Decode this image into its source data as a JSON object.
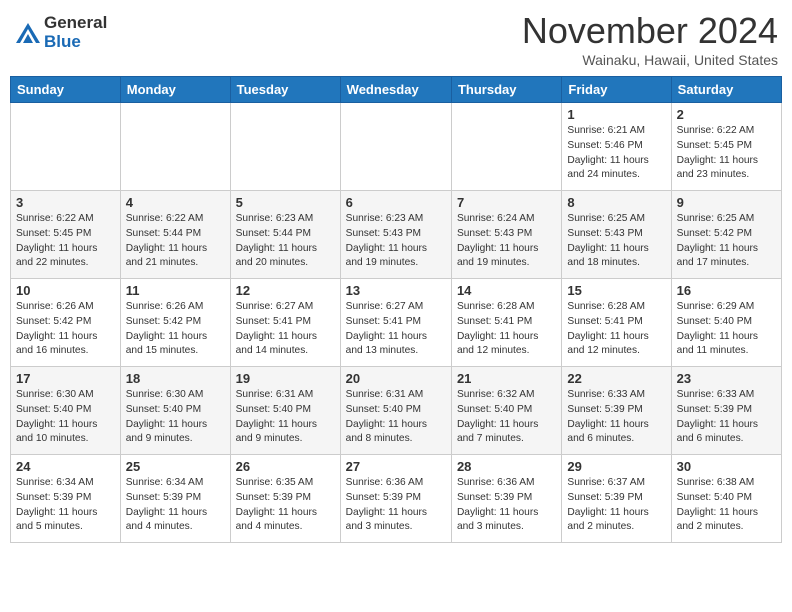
{
  "header": {
    "logo_general": "General",
    "logo_blue": "Blue",
    "month_title": "November 2024",
    "location": "Wainaku, Hawaii, United States"
  },
  "days_of_week": [
    "Sunday",
    "Monday",
    "Tuesday",
    "Wednesday",
    "Thursday",
    "Friday",
    "Saturday"
  ],
  "weeks": [
    [
      {
        "day": "",
        "info": ""
      },
      {
        "day": "",
        "info": ""
      },
      {
        "day": "",
        "info": ""
      },
      {
        "day": "",
        "info": ""
      },
      {
        "day": "",
        "info": ""
      },
      {
        "day": "1",
        "info": "Sunrise: 6:21 AM\nSunset: 5:46 PM\nDaylight: 11 hours and 24 minutes."
      },
      {
        "day": "2",
        "info": "Sunrise: 6:22 AM\nSunset: 5:45 PM\nDaylight: 11 hours and 23 minutes."
      }
    ],
    [
      {
        "day": "3",
        "info": "Sunrise: 6:22 AM\nSunset: 5:45 PM\nDaylight: 11 hours and 22 minutes."
      },
      {
        "day": "4",
        "info": "Sunrise: 6:22 AM\nSunset: 5:44 PM\nDaylight: 11 hours and 21 minutes."
      },
      {
        "day": "5",
        "info": "Sunrise: 6:23 AM\nSunset: 5:44 PM\nDaylight: 11 hours and 20 minutes."
      },
      {
        "day": "6",
        "info": "Sunrise: 6:23 AM\nSunset: 5:43 PM\nDaylight: 11 hours and 19 minutes."
      },
      {
        "day": "7",
        "info": "Sunrise: 6:24 AM\nSunset: 5:43 PM\nDaylight: 11 hours and 19 minutes."
      },
      {
        "day": "8",
        "info": "Sunrise: 6:25 AM\nSunset: 5:43 PM\nDaylight: 11 hours and 18 minutes."
      },
      {
        "day": "9",
        "info": "Sunrise: 6:25 AM\nSunset: 5:42 PM\nDaylight: 11 hours and 17 minutes."
      }
    ],
    [
      {
        "day": "10",
        "info": "Sunrise: 6:26 AM\nSunset: 5:42 PM\nDaylight: 11 hours and 16 minutes."
      },
      {
        "day": "11",
        "info": "Sunrise: 6:26 AM\nSunset: 5:42 PM\nDaylight: 11 hours and 15 minutes."
      },
      {
        "day": "12",
        "info": "Sunrise: 6:27 AM\nSunset: 5:41 PM\nDaylight: 11 hours and 14 minutes."
      },
      {
        "day": "13",
        "info": "Sunrise: 6:27 AM\nSunset: 5:41 PM\nDaylight: 11 hours and 13 minutes."
      },
      {
        "day": "14",
        "info": "Sunrise: 6:28 AM\nSunset: 5:41 PM\nDaylight: 11 hours and 12 minutes."
      },
      {
        "day": "15",
        "info": "Sunrise: 6:28 AM\nSunset: 5:41 PM\nDaylight: 11 hours and 12 minutes."
      },
      {
        "day": "16",
        "info": "Sunrise: 6:29 AM\nSunset: 5:40 PM\nDaylight: 11 hours and 11 minutes."
      }
    ],
    [
      {
        "day": "17",
        "info": "Sunrise: 6:30 AM\nSunset: 5:40 PM\nDaylight: 11 hours and 10 minutes."
      },
      {
        "day": "18",
        "info": "Sunrise: 6:30 AM\nSunset: 5:40 PM\nDaylight: 11 hours and 9 minutes."
      },
      {
        "day": "19",
        "info": "Sunrise: 6:31 AM\nSunset: 5:40 PM\nDaylight: 11 hours and 9 minutes."
      },
      {
        "day": "20",
        "info": "Sunrise: 6:31 AM\nSunset: 5:40 PM\nDaylight: 11 hours and 8 minutes."
      },
      {
        "day": "21",
        "info": "Sunrise: 6:32 AM\nSunset: 5:40 PM\nDaylight: 11 hours and 7 minutes."
      },
      {
        "day": "22",
        "info": "Sunrise: 6:33 AM\nSunset: 5:39 PM\nDaylight: 11 hours and 6 minutes."
      },
      {
        "day": "23",
        "info": "Sunrise: 6:33 AM\nSunset: 5:39 PM\nDaylight: 11 hours and 6 minutes."
      }
    ],
    [
      {
        "day": "24",
        "info": "Sunrise: 6:34 AM\nSunset: 5:39 PM\nDaylight: 11 hours and 5 minutes."
      },
      {
        "day": "25",
        "info": "Sunrise: 6:34 AM\nSunset: 5:39 PM\nDaylight: 11 hours and 4 minutes."
      },
      {
        "day": "26",
        "info": "Sunrise: 6:35 AM\nSunset: 5:39 PM\nDaylight: 11 hours and 4 minutes."
      },
      {
        "day": "27",
        "info": "Sunrise: 6:36 AM\nSunset: 5:39 PM\nDaylight: 11 hours and 3 minutes."
      },
      {
        "day": "28",
        "info": "Sunrise: 6:36 AM\nSunset: 5:39 PM\nDaylight: 11 hours and 3 minutes."
      },
      {
        "day": "29",
        "info": "Sunrise: 6:37 AM\nSunset: 5:39 PM\nDaylight: 11 hours and 2 minutes."
      },
      {
        "day": "30",
        "info": "Sunrise: 6:38 AM\nSunset: 5:40 PM\nDaylight: 11 hours and 2 minutes."
      }
    ]
  ]
}
